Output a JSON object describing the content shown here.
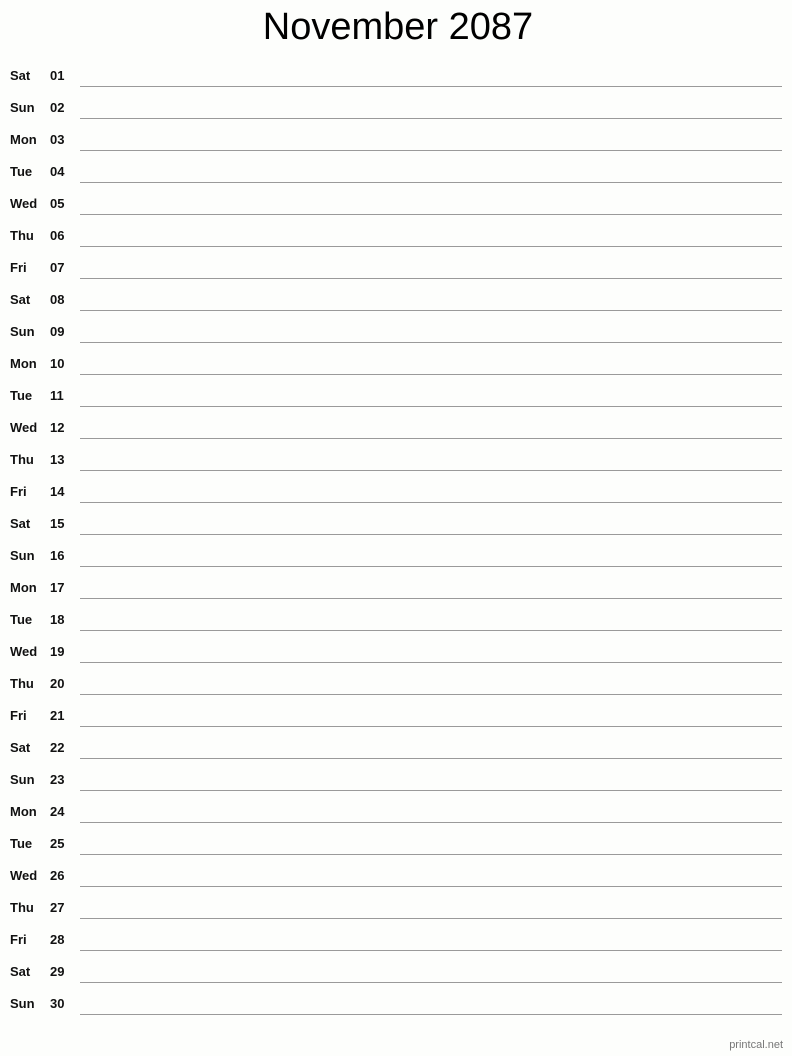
{
  "title": "November 2087",
  "days": [
    {
      "dow": "Sat",
      "num": "01"
    },
    {
      "dow": "Sun",
      "num": "02"
    },
    {
      "dow": "Mon",
      "num": "03"
    },
    {
      "dow": "Tue",
      "num": "04"
    },
    {
      "dow": "Wed",
      "num": "05"
    },
    {
      "dow": "Thu",
      "num": "06"
    },
    {
      "dow": "Fri",
      "num": "07"
    },
    {
      "dow": "Sat",
      "num": "08"
    },
    {
      "dow": "Sun",
      "num": "09"
    },
    {
      "dow": "Mon",
      "num": "10"
    },
    {
      "dow": "Tue",
      "num": "11"
    },
    {
      "dow": "Wed",
      "num": "12"
    },
    {
      "dow": "Thu",
      "num": "13"
    },
    {
      "dow": "Fri",
      "num": "14"
    },
    {
      "dow": "Sat",
      "num": "15"
    },
    {
      "dow": "Sun",
      "num": "16"
    },
    {
      "dow": "Mon",
      "num": "17"
    },
    {
      "dow": "Tue",
      "num": "18"
    },
    {
      "dow": "Wed",
      "num": "19"
    },
    {
      "dow": "Thu",
      "num": "20"
    },
    {
      "dow": "Fri",
      "num": "21"
    },
    {
      "dow": "Sat",
      "num": "22"
    },
    {
      "dow": "Sun",
      "num": "23"
    },
    {
      "dow": "Mon",
      "num": "24"
    },
    {
      "dow": "Tue",
      "num": "25"
    },
    {
      "dow": "Wed",
      "num": "26"
    },
    {
      "dow": "Thu",
      "num": "27"
    },
    {
      "dow": "Fri",
      "num": "28"
    },
    {
      "dow": "Sat",
      "num": "29"
    },
    {
      "dow": "Sun",
      "num": "30"
    }
  ],
  "footer": "printcal.net"
}
